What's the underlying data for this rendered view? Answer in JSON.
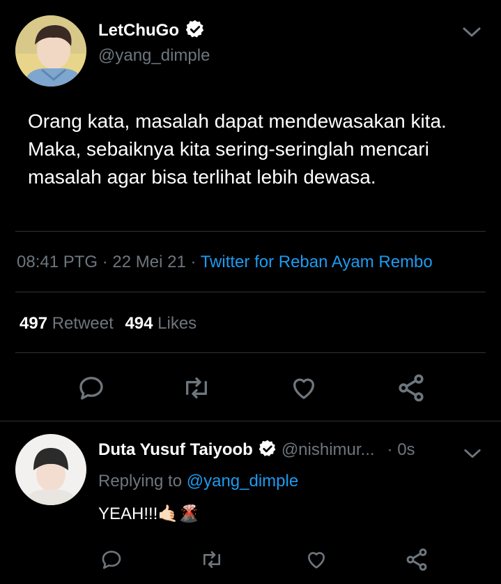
{
  "tweet": {
    "name": "LetChuGo",
    "handle": "@yang_dimple",
    "text": "Orang kata, masalah dapat mendewasakan kita. Maka, sebaiknya kita sering-seringlah mencari masalah agar bisa terlihat lebih dewasa.",
    "time": "08:41 PTG",
    "sep": "·",
    "date": "22 Mei 21",
    "sep2": "·",
    "source": "Twitter for Reban Ayam Rembo",
    "retweets_count": "497",
    "retweets_label": "Retweet",
    "likes_count": "494",
    "likes_label": "Likes"
  },
  "reply": {
    "name": "Duta Yusuf Taiyoob",
    "handle": "@nishimur...",
    "time": "· 0s",
    "replying_prefix": "Replying to",
    "replying_to": "@yang_dimple",
    "text": "YEAH!!!",
    "emojis": "🤙🏻🌋"
  },
  "colors": {
    "background": "#000000",
    "muted": "#6e767d",
    "link": "#1d9bf0",
    "divider": "#2f3336"
  },
  "icons": [
    "verified-icon",
    "chevron-down-icon",
    "reply-icon",
    "retweet-icon",
    "like-icon",
    "share-icon"
  ]
}
